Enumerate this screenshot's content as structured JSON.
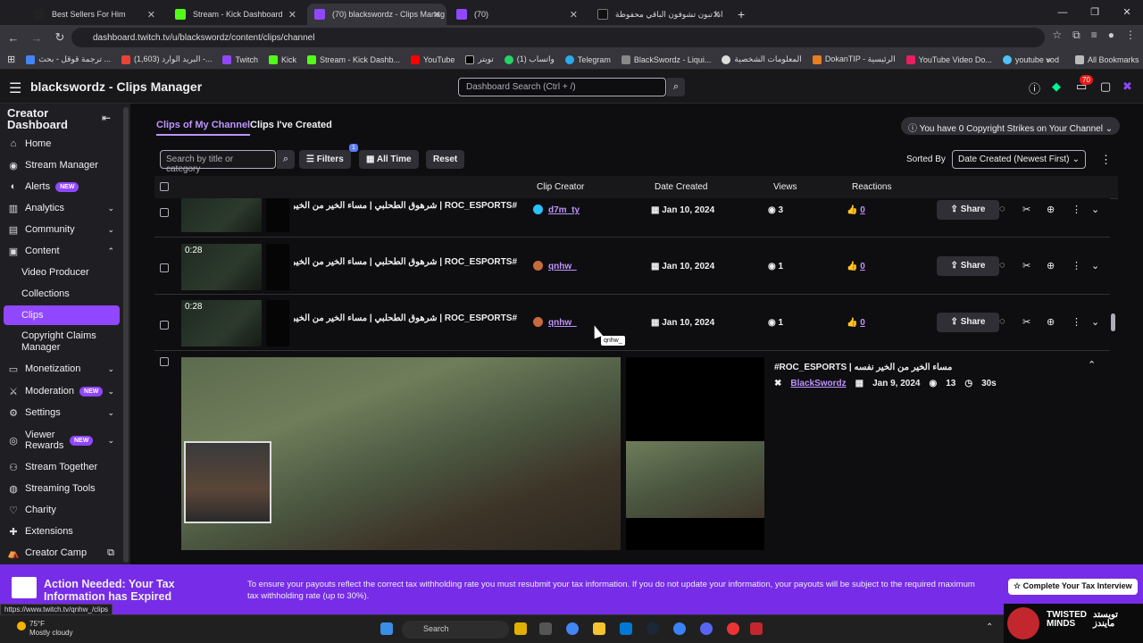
{
  "browser": {
    "tabs": [
      {
        "title": "Best Sellers For Him"
      },
      {
        "title": "Stream - Kick Dashboard"
      },
      {
        "title": "(70) blackswordz - Clips Manag"
      },
      {
        "title": "(70) ‏‏‏‏‏‏‏‏‏‏‏‏‏‏‏‏‏‏‏‏‏‏‏‏‏‏‏‏‏‏‏‏‏‏‏‏‏"
      },
      {
        "title": "اذا تبون تشوفون الباقي محفوظة"
      }
    ],
    "url": "dashboard.twitch.tv/u/blackswordz/content/clips/channel",
    "bookmarks": [
      "ترجمة قوقل - بحث ...",
      "(1,603) البريد الوارد -...",
      "Twitch",
      "Kick",
      "Stream - Kick Dashb...",
      "YouTube",
      "تويتر",
      "واتساب (1)",
      "Telegram",
      "BlackSwordz - Liqui...",
      "المعلومات الشخصية",
      "DokanTIP - الرئيسية",
      "YouTube Video Do...",
      "youtube vod"
    ],
    "all_bookmarks": "All Bookmarks"
  },
  "header": {
    "title": "blackswordz - Clips Manager",
    "search_placeholder": "Dashboard Search (Ctrl + /)",
    "notif_count": "70"
  },
  "sidebar": {
    "heading": "Creator Dashboard",
    "items": [
      {
        "label": "Home"
      },
      {
        "label": "Stream Manager"
      },
      {
        "label": "Alerts",
        "badge": "NEW"
      },
      {
        "label": "Analytics"
      },
      {
        "label": "Community"
      },
      {
        "label": "Content"
      },
      {
        "label": "Video Producer"
      },
      {
        "label": "Collections"
      },
      {
        "label": "Clips"
      },
      {
        "label": "Copyright Claims Manager"
      },
      {
        "label": "Monetization"
      },
      {
        "label": "Moderation",
        "badge": "NEW"
      },
      {
        "label": "Settings"
      },
      {
        "label": "Viewer Rewards",
        "badge": "NEW"
      },
      {
        "label": "Stream Together"
      },
      {
        "label": "Streaming Tools"
      },
      {
        "label": "Charity"
      },
      {
        "label": "Extensions"
      },
      {
        "label": "Creator Camp"
      }
    ]
  },
  "main": {
    "tab_my": "Clips of My Channel",
    "tab_created": "Clips I've Created",
    "strikes": "You have 0 Copyright Strikes on Your Channel",
    "filter_placeholder": "Search by title or category",
    "filters_label": "Filters",
    "filters_count": "1",
    "time_label": "All Time",
    "reset_label": "Reset",
    "sorted_by": "Sorted By",
    "sort_value": "Date Created (Newest First)",
    "columns": {
      "creator": "Clip Creator",
      "date": "Date Created",
      "views": "Views",
      "reactions": "Reactions"
    },
    "rows": [
      {
        "duration": "",
        "title": "#ROC_ESPORTS | شرهوق الطحلبي | مساء الخير من الخير نفسه",
        "creator": "d7m_ty",
        "date": "Jan 10, 2024",
        "views": "3",
        "reactions": "0",
        "share": "Share"
      },
      {
        "duration": "0:28",
        "title": "#ROC_ESPORTS | شرهوق الطحلبي | مساء الخير من الخير نفسه",
        "creator": "qnhw_",
        "date": "Jan 10, 2024",
        "views": "1",
        "reactions": "0",
        "share": "Share"
      },
      {
        "duration": "0:28",
        "title": "#ROC_ESPORTS | شرهوق الطحلبي | مساء الخير من الخير نفسه",
        "creator": "qnhw_",
        "date": "Jan 10, 2024",
        "views": "1",
        "reactions": "0",
        "share": "Share"
      }
    ],
    "tooltip": "qnhw_",
    "expanded": {
      "title": "#ROC_ESPORTS | مساء الخير من الخير نفسه",
      "creator": "BlackSwordz",
      "date": "Jan 9, 2024",
      "views": "13",
      "duration": "30s"
    }
  },
  "banner": {
    "title": "Action Needed: Your Tax Information has Expired",
    "body": "To ensure your payouts reflect the correct tax withholding rate you must resubmit your tax information. If you do not update your information, your payouts will be subject to the required maximum tax withholding rate (up to 30%).",
    "button": "Complete Your Tax Interview"
  },
  "status_url": "https://www.twitch.tv/qnhw_/clips",
  "taskbar": {
    "temp": "75°F",
    "weather": "Mostly cloudy",
    "search": "Search"
  },
  "brand": {
    "line1": "TWISTED",
    "line2": "MINDS",
    "ar1": "تويستد",
    "ar2": "مايندز"
  }
}
